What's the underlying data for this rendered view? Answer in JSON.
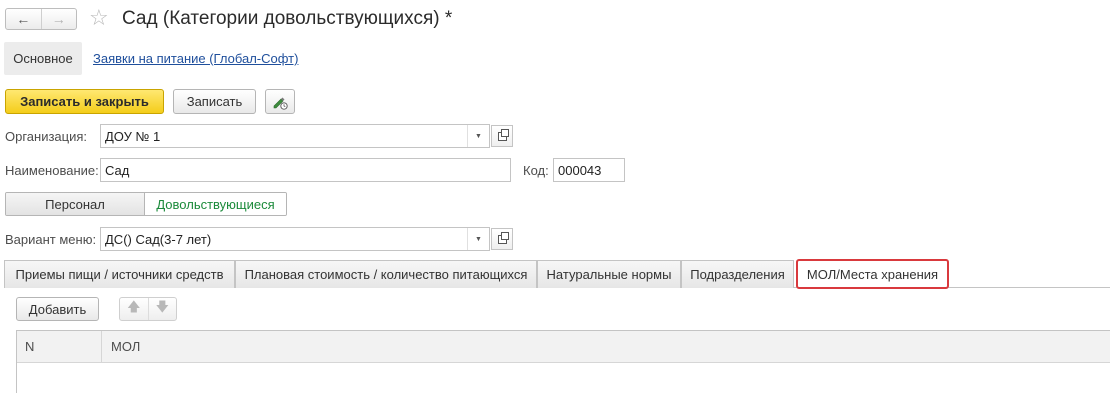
{
  "header": {
    "title": "Сад (Категории довольствующихся) *",
    "back_icon": "arrow-left-icon",
    "forward_icon": "arrow-right-icon",
    "favorite_icon": "star-icon"
  },
  "section_tabs": {
    "main": "Основное",
    "link": "Заявки на питание (Глобал-Софт)"
  },
  "toolbar": {
    "save_close": "Записать и закрыть",
    "save": "Записать",
    "edit_icon": "pen-clock-icon"
  },
  "form": {
    "org_label": "Организация:",
    "org_value": "ДОУ № 1",
    "name_label": "Наименование:",
    "name_value": "Сад",
    "code_label": "Код:",
    "code_value": "000043",
    "switch_left": "Персонал",
    "switch_right": "Довольствующиеся",
    "menu_label": "Вариант меню:",
    "menu_value": "ДС() Сад(3-7 лет)"
  },
  "tabs": [
    {
      "label": "Приемы пищи / источники средств"
    },
    {
      "label": "Плановая стоимость / количество питающихся"
    },
    {
      "label": "Натуральные нормы"
    },
    {
      "label": "Подразделения"
    },
    {
      "label": "МОЛ/Места хранения"
    }
  ],
  "table_toolbar": {
    "add": "Добавить",
    "up_icon": "arrow-up-icon",
    "down_icon": "arrow-down-icon"
  },
  "table": {
    "columns": [
      "N",
      "МОЛ"
    ]
  },
  "colors": {
    "primary_button": "#f4cd1a",
    "active_tab_border": "#d9393d",
    "link": "#1f4f9c",
    "switch_selected_text": "#1b8a3a"
  }
}
